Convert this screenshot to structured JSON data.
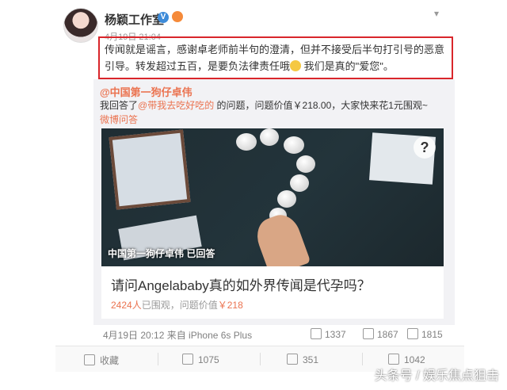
{
  "post": {
    "author": "杨颖工作室",
    "time": "4月19日 21:04",
    "text_before_emoji": "传闻就是谣言，感谢卓老师前半句的澄清，但并不接受后半句打引号的恶意引导。转发超过五百，是要负法律责任哦",
    "text_after_emoji": " 我们是真的\"爱您\"。"
  },
  "repost": {
    "author": "@中国第一狗仔卓伟",
    "text_prefix": "我回答了",
    "text_link": "@带我去吃好吃的",
    "text_suffix": " 的问题，问题价值￥218.00，大家快来花1元围观~",
    "source": "微博问答",
    "media_caption": "中国第一狗仔卓伟 已回答",
    "question_title": "请问Angelababy真的如外界传闻是代孕吗？",
    "views_count": "2424人",
    "views_label": "已围观，问题价值",
    "question_value": "￥218"
  },
  "repost_footer": {
    "time_source": "4月19日 20:12 来自 iPhone 6s Plus",
    "forwards": "1337",
    "comments": "1867",
    "likes": "1815"
  },
  "actions": {
    "favorite": "收藏",
    "forward": "1075",
    "comment": "351",
    "like": "1042"
  },
  "watermark": "头条号 / 娱乐焦点狙击",
  "colors": {
    "accent": "#eb7350",
    "highlight_border": "#d9262b",
    "verified": "#3d8bd9"
  }
}
